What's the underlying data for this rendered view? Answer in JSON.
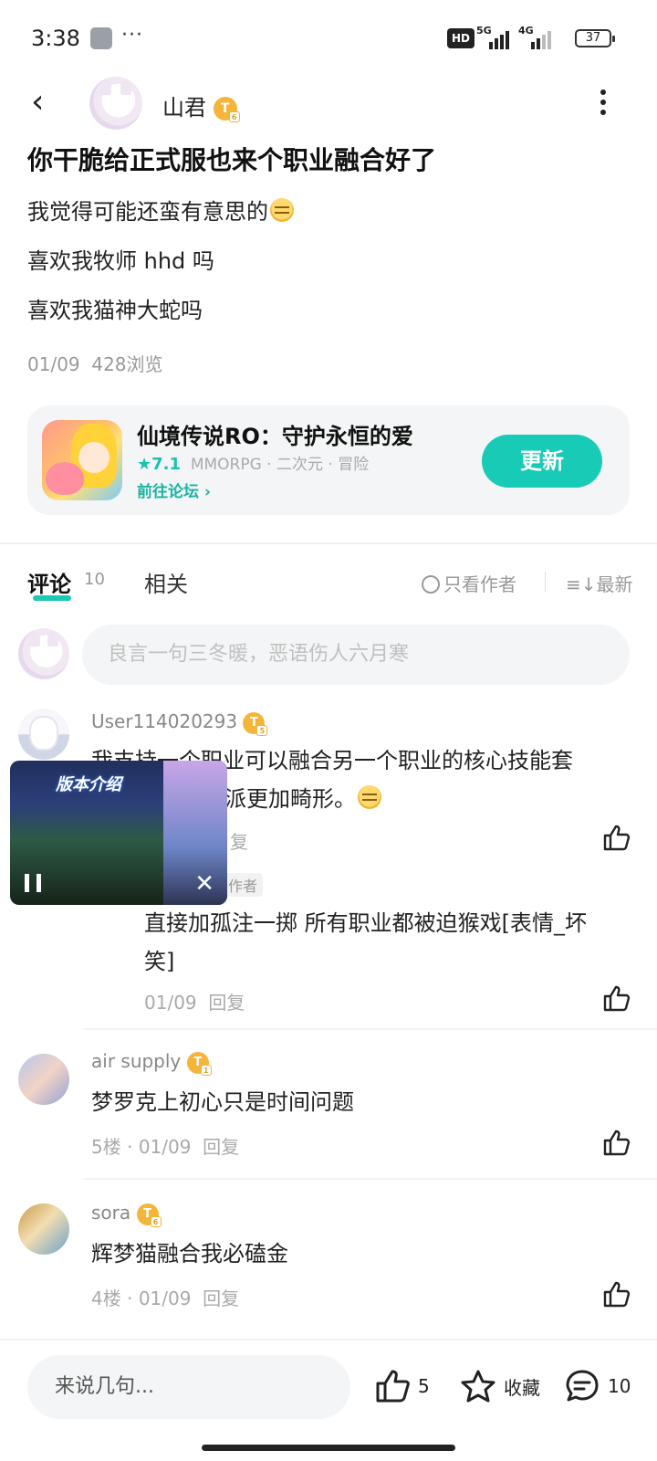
{
  "status_bar": {
    "time": "3:38",
    "more": "···",
    "hd_label": "HD",
    "network1": "5G",
    "network2": "4G",
    "battery": "37"
  },
  "header": {
    "author_name": "山君",
    "level_badge": "T",
    "level_num": "6"
  },
  "post": {
    "title": "你干脆给正式服也来个职业融合好了",
    "lines": [
      "我觉得可能还蛮有意思的",
      "喜欢我牧师 hhd 吗",
      "喜欢我猫神大蛇吗"
    ],
    "date": "01/09",
    "views": "428浏览"
  },
  "game_card": {
    "name": "仙境传说RO：守护永恒的爱",
    "rating": "7.1",
    "tags": "MMORPG · 二次元 · 冒险",
    "link": "前往论坛",
    "button": "更新"
  },
  "tabs": {
    "comments_label": "评论",
    "comments_count": "10",
    "related_label": "相关",
    "author_only": "只看作者",
    "sort": "最新"
  },
  "comment_input": {
    "placeholder": "良言一句三冬暖，恶语伤人六月寒"
  },
  "comments": [
    {
      "user": "User114020293",
      "level": "5",
      "text_line1": "我支持一个职业可以融合另一个职业的核心技能套",
      "text_line2": "派更加畸形。",
      "reply": "复",
      "reply_author_tag": "作者",
      "reply_text_line1": "直接加孤注一掷 所有职业都被迫猴戏[表情_坏",
      "reply_text_line2": "笑]",
      "reply_date": "01/09",
      "reply_reply": "回复"
    },
    {
      "user": "air supply",
      "level": "1",
      "text": "梦罗克上初心只是时间问题",
      "floor": "5楼",
      "date": "01/09",
      "reply": "回复"
    },
    {
      "user": "sora",
      "level": "6",
      "text": "辉梦猫融合我必磕金",
      "floor": "4楼",
      "date": "01/09",
      "reply": "回复"
    }
  ],
  "video_popup": {
    "banner": "版本介绍",
    "close": "✕"
  },
  "bottom_bar": {
    "input_placeholder": "来说几句...",
    "likes": "5",
    "favorite": "收藏",
    "comments": "10"
  }
}
